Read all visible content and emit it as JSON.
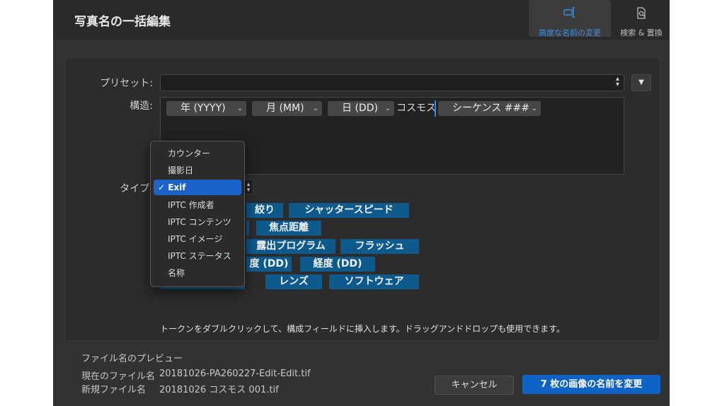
{
  "window": {
    "title": "写真名の一括編集"
  },
  "modes": {
    "advanced": {
      "label": "高度な名前の変更",
      "icon": "rename-pen-icon",
      "active": true
    },
    "search": {
      "label": "検索 & 置換",
      "icon": "search-document-icon",
      "active": false
    }
  },
  "preset": {
    "label": "プリセット:",
    "value": ""
  },
  "structure": {
    "label": "構造:",
    "tokens": [
      {
        "text": "年 (YYYY)"
      },
      {
        "text": "月 (MM)"
      },
      {
        "text": "日 (DD)"
      },
      {
        "text": "シーケンス ###"
      }
    ],
    "separator_text": "コスモス"
  },
  "type": {
    "label": "タイプ:"
  },
  "type_menu": {
    "items": [
      "カウンター",
      "撮影日",
      "Exif",
      "IPTC 作成者",
      "IPTC コンテンツ",
      "IPTC イメージ",
      "IPTC ステータス",
      "名称"
    ],
    "selected": "Exif",
    "selected_display": "✓ Exif"
  },
  "chips": {
    "row1": [
      "絞り",
      "シャッタースピード"
    ],
    "row2": [
      "焦点距離"
    ],
    "row3": [
      "露出プログラム",
      "フラッシュ"
    ],
    "row4": [
      "度 (DD)",
      "経度 (DD)"
    ],
    "row5": [
      "レンズ",
      "ソフトウェア"
    ]
  },
  "hint": "トークンをダブルクリックして、構成フィールドに挿入します。ドラッグアンドドロップも使用できます。",
  "preview": {
    "title": "ファイル名のプレビュー",
    "current_label": "現在のファイル名",
    "current_value": "20181026-PA260227-Edit-Edit.tif",
    "new_label": "新規ファイル名",
    "new_value": "20181026 コスモス 001.tif"
  },
  "buttons": {
    "cancel": "キャンセル",
    "rename": "7 枚の画像の名前を変更"
  },
  "colors": {
    "accent": "#2f8de4",
    "chip": "#0f5a8d",
    "primary_button": "#0f63c4",
    "menu_selection": "#1b63c8"
  }
}
